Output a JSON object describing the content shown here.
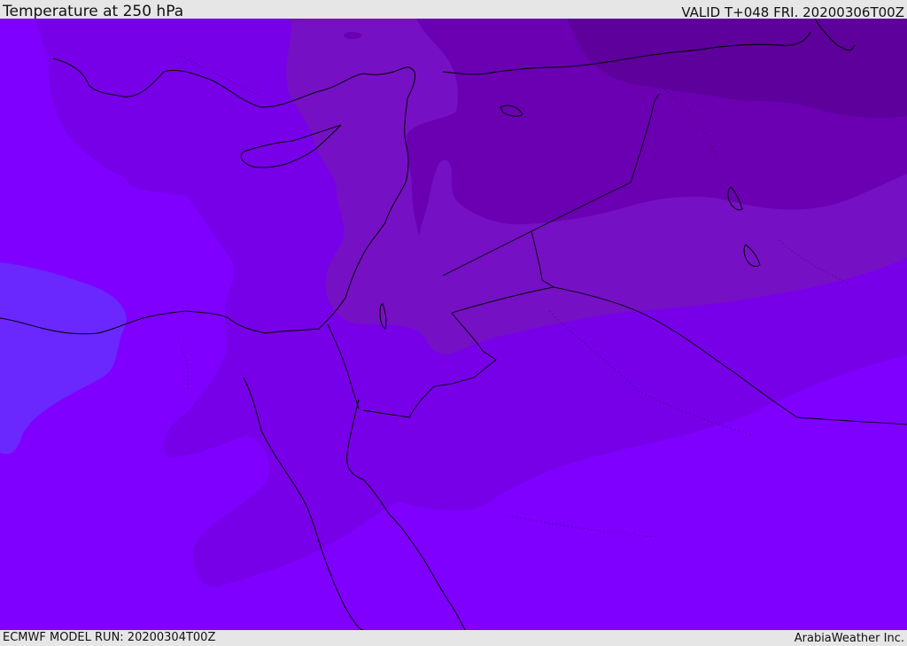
{
  "header": {
    "title": "Temperature at 250 hPa",
    "valid": "VALID T+048 FRI. 20200306T00Z"
  },
  "footer": {
    "model_run": "ECMWF MODEL RUN: 20200304T00Z",
    "credit": "ArabiaWeather Inc."
  },
  "map": {
    "variable": "temperature",
    "level": "250 hPa",
    "colors": {
      "warm_band": "#6a28ff",
      "base": "#7f00ff",
      "band_1": "#7700e8",
      "band_2": "#7610c4",
      "band_3": "#6a00b2",
      "band_4": "#5e009c",
      "coastline": "#000000"
    }
  }
}
